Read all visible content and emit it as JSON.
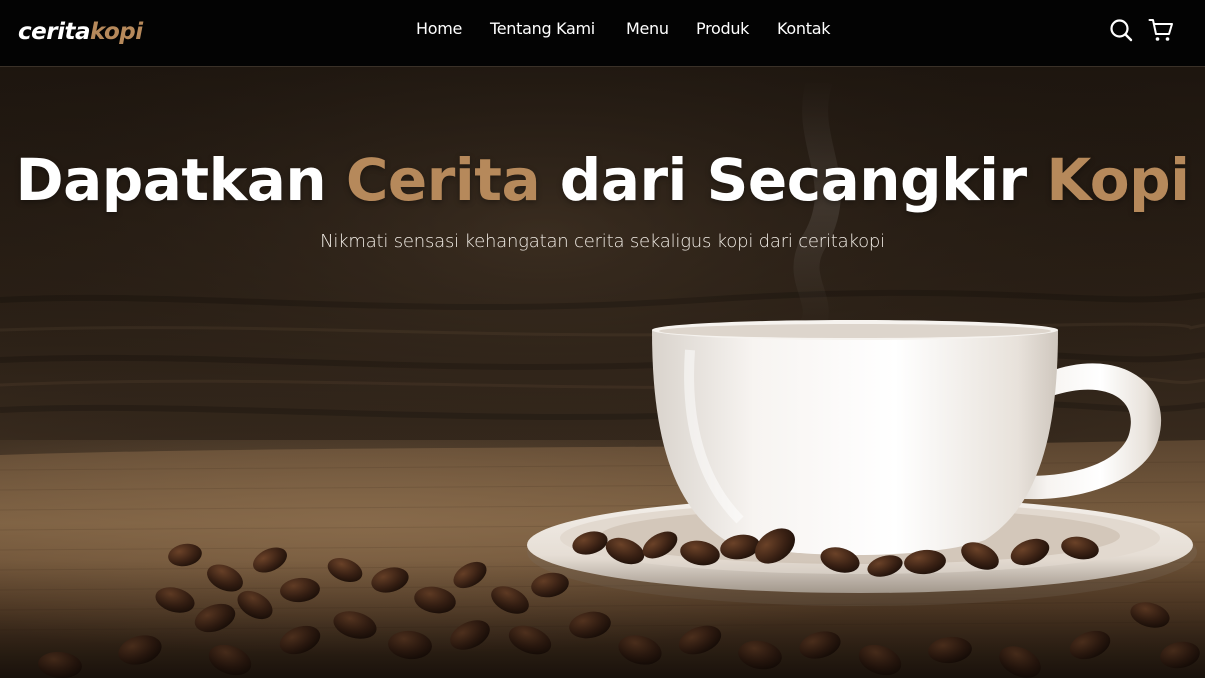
{
  "brand": {
    "part1": "cerita",
    "part2": "kopi"
  },
  "nav": {
    "links": [
      "Home",
      "Tentang Kami",
      "Menu",
      "Produk",
      "Kontak"
    ],
    "icons": [
      "search-icon",
      "shopping-cart-icon"
    ]
  },
  "hero": {
    "title_part1": "Dapatkan ",
    "title_accent1": "Cerita",
    "title_part2": " dari Secangkir ",
    "title_accent2": "Kopi",
    "subtitle": "Nikmati sensasi kehangatan cerita sekaligus kopi dari ceritakopi",
    "background_image": "white coffee cup on saucer with coffee beans on burlap"
  },
  "colors": {
    "accent": "#b6895b",
    "navbar_bg": "#030303",
    "text": "#ffffff"
  }
}
